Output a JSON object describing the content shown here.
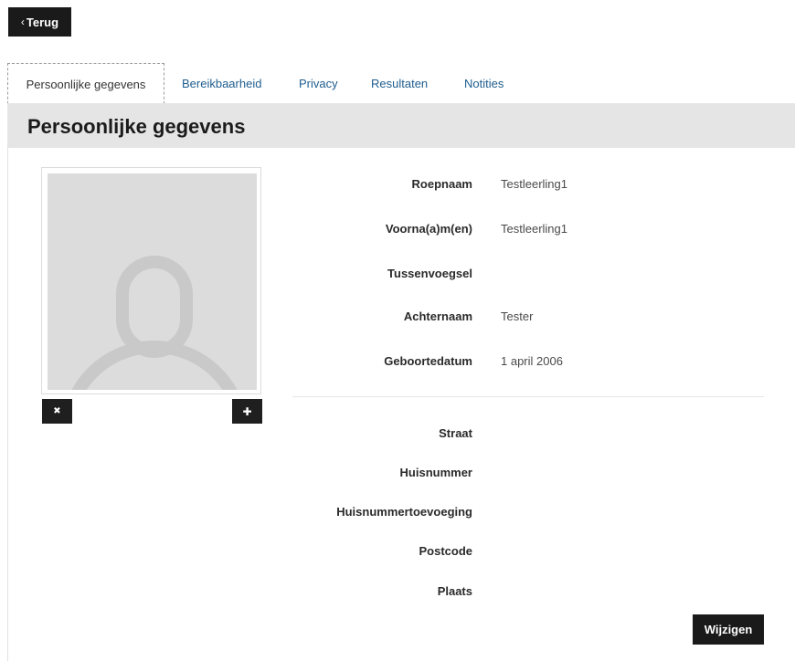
{
  "back_button": {
    "label": "Terug",
    "chevron": "‹"
  },
  "tabs": [
    {
      "label": "Persoonlijke gegevens",
      "active": true
    },
    {
      "label": "Bereikbaarheid",
      "active": false
    },
    {
      "label": "Privacy",
      "active": false
    },
    {
      "label": "Resultaten",
      "active": false
    },
    {
      "label": "Notities",
      "active": false
    }
  ],
  "section": {
    "title": "Persoonlijke gegevens"
  },
  "photo": {
    "placeholder_icon": "user-silhouette-icon",
    "remove_icon": "close-icon",
    "add_icon": "plus-icon",
    "remove_glyph": "✖",
    "add_glyph": "✚"
  },
  "personal": [
    {
      "label": "Roepnaam",
      "value": "Testleerling1"
    },
    {
      "label": "Voorna(a)m(en)",
      "value": "Testleerling1"
    },
    {
      "label": "Tussenvoegsel",
      "value": ""
    },
    {
      "label": "Achternaam",
      "value": "Tester"
    },
    {
      "label": "Geboortedatum",
      "value": "1 april 2006"
    }
  ],
  "address": [
    {
      "label": "Straat",
      "value": ""
    },
    {
      "label": "Huisnummer",
      "value": ""
    },
    {
      "label": "Huisnummertoevoeging",
      "value": ""
    },
    {
      "label": "Postcode",
      "value": ""
    },
    {
      "label": "Plaats",
      "value": ""
    }
  ],
  "edit_button": {
    "label": "Wijzigen"
  },
  "colors": {
    "tab_link": "#1f5d8f",
    "dark_button": "#1a1a1a",
    "header_band": "#e5e5e5",
    "photo_placeholder": "#dcdcdc"
  }
}
